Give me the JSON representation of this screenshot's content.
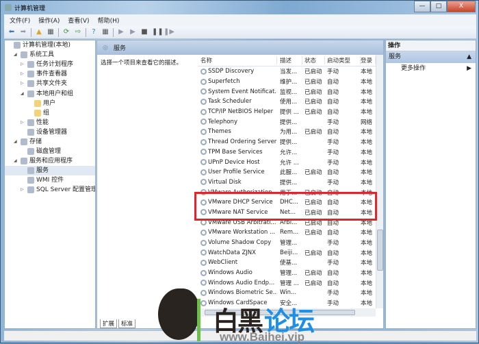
{
  "window": {
    "title": "计算机管理",
    "minimize": "—",
    "maximize": "□",
    "close": "X"
  },
  "menu": [
    "文件(F)",
    "操作(A)",
    "查看(V)",
    "帮助(H)"
  ],
  "toolbar": [
    "back-icon",
    "forward-icon",
    "up-icon",
    "show-hide-tree-icon",
    "refresh-icon",
    "export-icon",
    "help-icon",
    "properties-icon",
    "play-icon",
    "play-alt-icon",
    "stop-icon",
    "pause-icon",
    "resume-icon"
  ],
  "tree": [
    {
      "label": "计算机管理(本地)",
      "level": 0,
      "arrow": ""
    },
    {
      "label": "系统工具",
      "level": 1,
      "arrow": "◢"
    },
    {
      "label": "任务计划程序",
      "level": 2,
      "arrow": "▷"
    },
    {
      "label": "事件查看器",
      "level": 2,
      "arrow": "▷"
    },
    {
      "label": "共享文件夹",
      "level": 2,
      "arrow": "▷"
    },
    {
      "label": "本地用户和组",
      "level": 2,
      "arrow": "◢"
    },
    {
      "label": "用户",
      "level": 3,
      "arrow": ""
    },
    {
      "label": "组",
      "level": 3,
      "arrow": ""
    },
    {
      "label": "性能",
      "level": 2,
      "arrow": "▷"
    },
    {
      "label": "设备管理器",
      "level": 2,
      "arrow": ""
    },
    {
      "label": "存储",
      "level": 1,
      "arrow": "◢"
    },
    {
      "label": "磁盘管理",
      "level": 2,
      "arrow": ""
    },
    {
      "label": "服务和应用程序",
      "level": 1,
      "arrow": "◢"
    },
    {
      "label": "服务",
      "level": 2,
      "arrow": ""
    },
    {
      "label": "WMI 控件",
      "level": 2,
      "arrow": ""
    },
    {
      "label": "SQL Server 配置管理器",
      "level": 2,
      "arrow": "▷"
    }
  ],
  "main": {
    "header": "服务",
    "description": "选择一个项目来查看它的描述。",
    "columns": [
      "名称",
      "描述",
      "状态",
      "启动类型",
      "登录"
    ],
    "rows": [
      [
        "SSDP Discovery",
        "当发...",
        "已启动",
        "手动",
        "本地"
      ],
      [
        "Superfetch",
        "维护...",
        "已启动",
        "自动",
        "本地"
      ],
      [
        "System Event Notificat...",
        "监视...",
        "已启动",
        "自动",
        "本地"
      ],
      [
        "Task Scheduler",
        "使用...",
        "已启动",
        "自动",
        "本地"
      ],
      [
        "TCP/IP NetBIOS Helper",
        "提供 ...",
        "已启动",
        "自动",
        "本地"
      ],
      [
        "Telephony",
        "提供...",
        "",
        "手动",
        "网络"
      ],
      [
        "Themes",
        "为用...",
        "已启动",
        "自动",
        "本地"
      ],
      [
        "Thread Ordering Server",
        "提供...",
        "",
        "手动",
        "本地"
      ],
      [
        "TPM Base Services",
        "允许...",
        "",
        "手动",
        "本地"
      ],
      [
        "UPnP Device Host",
        "允许 ...",
        "",
        "手动",
        "本地"
      ],
      [
        "User Profile Service",
        "此服...",
        "已启动",
        "自动",
        "本地"
      ],
      [
        "Virtual Disk",
        "提供...",
        "",
        "手动",
        "本地"
      ],
      [
        "VMware Authorization ...",
        "用于...",
        "已启动",
        "自动",
        "本地"
      ],
      [
        "VMware DHCP Service",
        "DHC...",
        "已启动",
        "自动",
        "本地"
      ],
      [
        "VMware NAT Service",
        "Net...",
        "已启动",
        "自动",
        "本地"
      ],
      [
        "VMware USB Arbitrati...",
        "Arbi...",
        "已启动",
        "自动",
        "本地"
      ],
      [
        "VMware Workstation ...",
        "Rem...",
        "已启动",
        "自动",
        "本地"
      ],
      [
        "Volume Shadow Copy",
        "管理...",
        "",
        "手动",
        "本地"
      ],
      [
        "WatchData ZJNX",
        "Beiji...",
        "已启动",
        "自动",
        "本地"
      ],
      [
        "WebClient",
        "使基...",
        "",
        "手动",
        "本地"
      ],
      [
        "Windows Audio",
        "管理...",
        "已启动",
        "自动",
        "本地"
      ],
      [
        "Windows Audio Endp...",
        "管理 ...",
        "已启动",
        "自动",
        "本地"
      ],
      [
        "Windows Biometric Se...",
        "Win...",
        "",
        "手动",
        "本地"
      ],
      [
        "Windows CardSpace",
        "安全...",
        "",
        "手动",
        "本地"
      ]
    ],
    "tabs": [
      "扩展",
      "标准"
    ]
  },
  "actions": {
    "title": "操作",
    "section": "服务",
    "item": "更多操作"
  },
  "watermark": {
    "cn1": "白黑",
    "cn2": "论坛",
    "url": "www.Baihei.vip"
  },
  "colors": {
    "highlight": "#e0262a",
    "brand_blue": "#1e8ee6"
  }
}
